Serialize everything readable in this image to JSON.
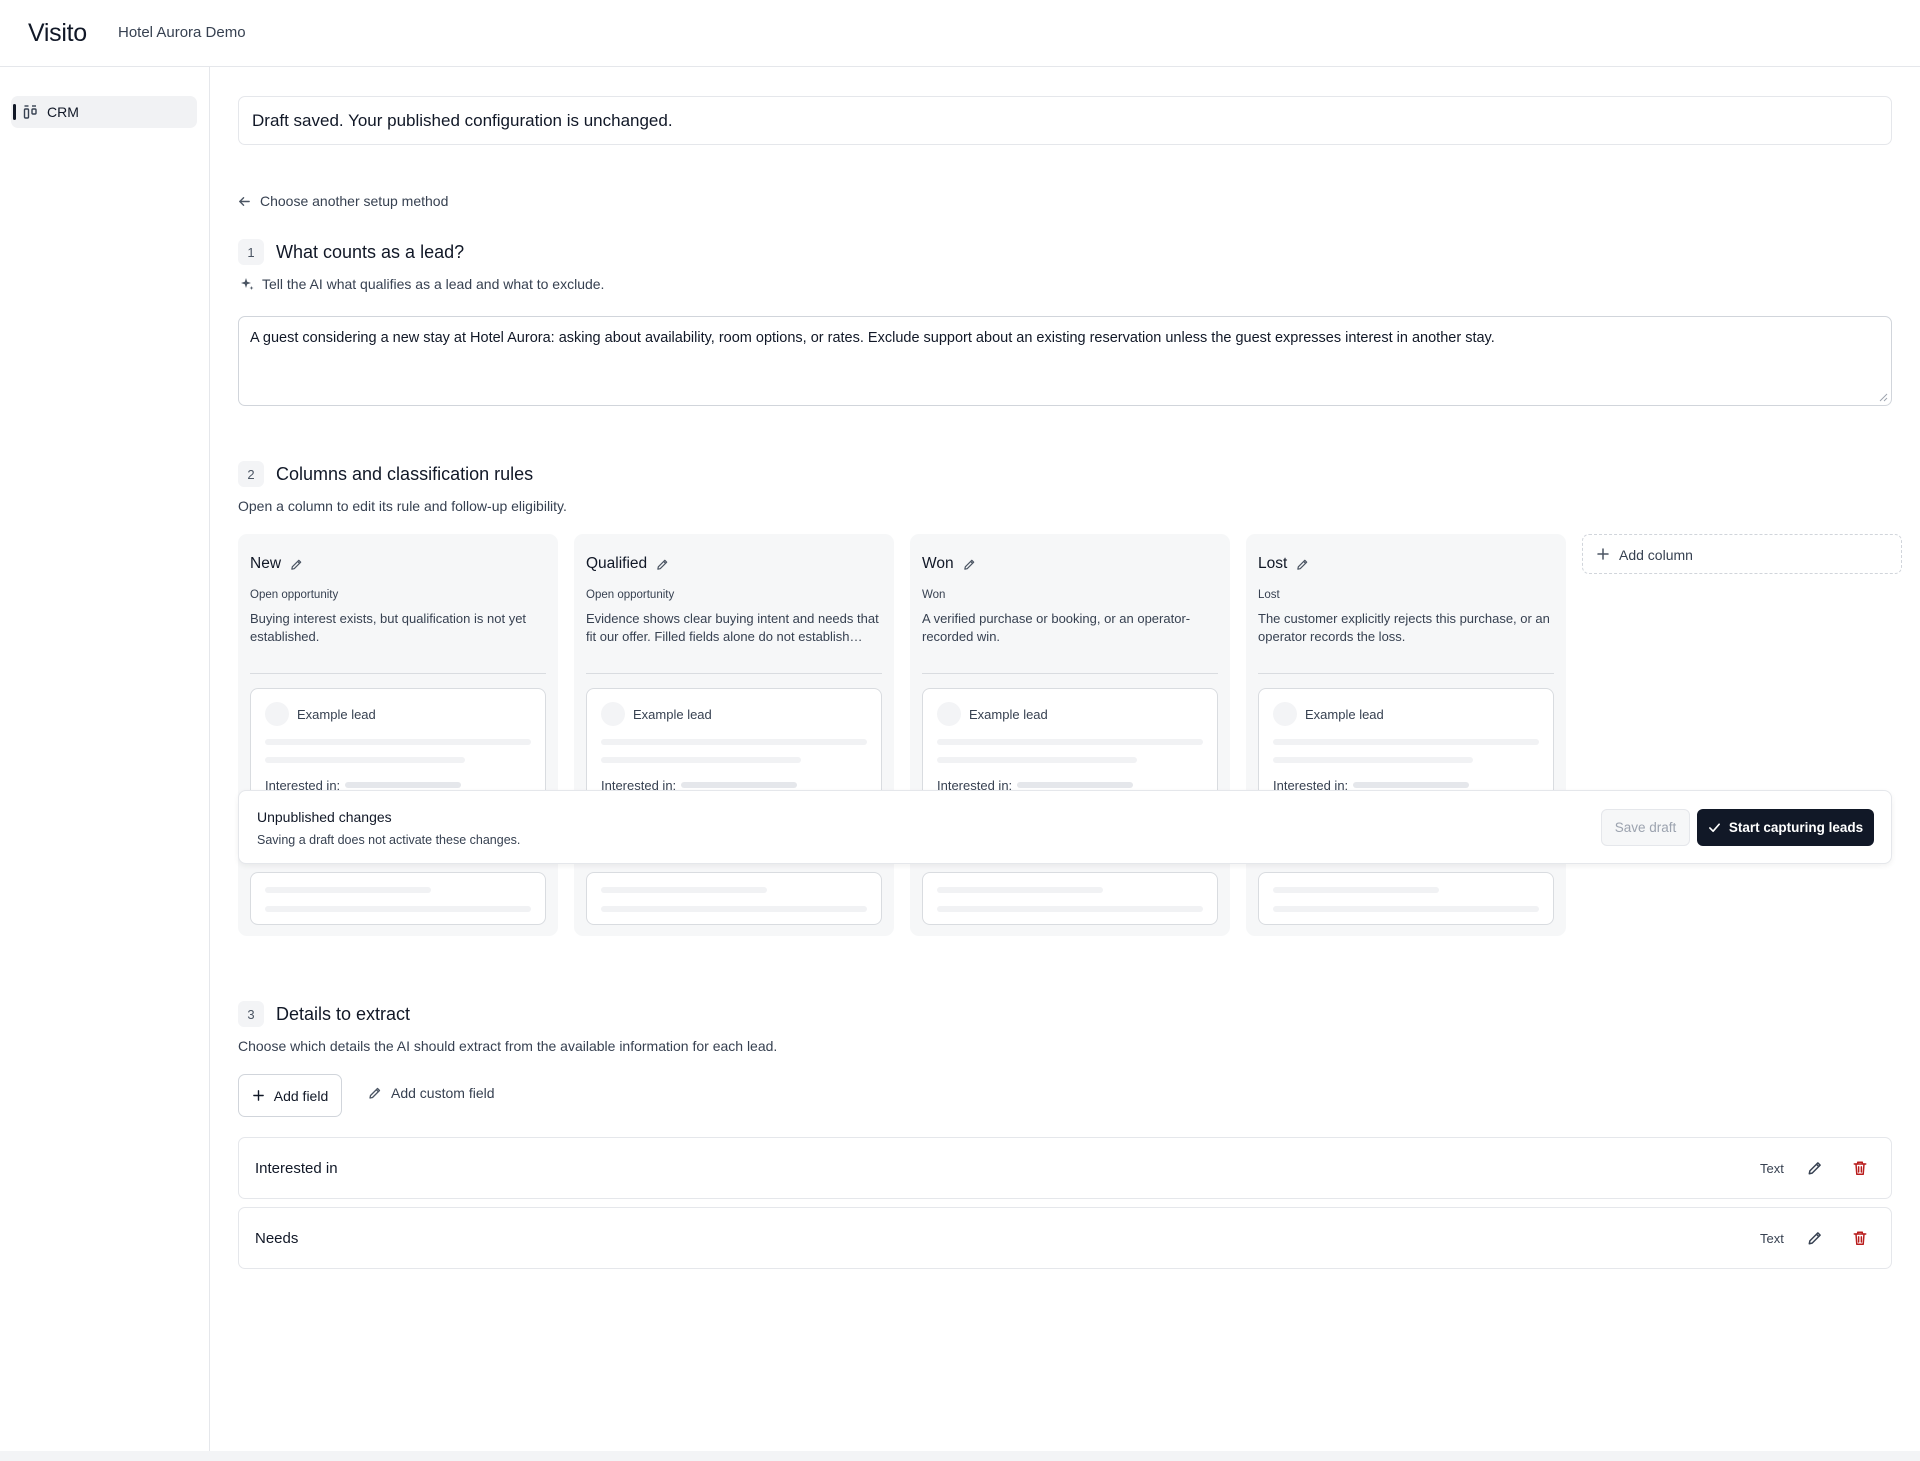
{
  "app": {
    "brand": "Visito",
    "workspace": "Hotel Aurora Demo"
  },
  "sidebar": {
    "items": [
      {
        "label": "CRM",
        "icon": "crm-icon"
      }
    ]
  },
  "toast": {
    "message": "Draft saved. Your published configuration is unchanged."
  },
  "back_link": {
    "label": "Choose another setup method",
    "icon": "arrow-left-icon"
  },
  "section1": {
    "number": "1",
    "title": "What counts as a lead?",
    "hint": "Tell the AI what qualifies as a lead and what to exclude.",
    "hint_icon": "sparkle-icon",
    "definition": "A guest considering a new stay at Hotel Aurora: asking about availability, room options, or rates. Exclude support about an existing reservation unless the guest expresses interest in another stay."
  },
  "section2": {
    "number": "2",
    "title": "Columns and classification rules",
    "description": "Open a column to edit its rule and follow-up eligibility.",
    "columns": [
      {
        "name": "New",
        "type": "Open opportunity",
        "rule": "Buying interest exists, but qualification is not yet established.",
        "example": "Example lead",
        "interested_label": "Interested in:"
      },
      {
        "name": "Qualified",
        "type": "Open opportunity",
        "rule": "Evidence shows clear buying intent and needs that fit our offer. Filled fields alone do not establish…",
        "example": "Example lead",
        "interested_label": "Interested in:"
      },
      {
        "name": "Won",
        "type": "Won",
        "rule": "A verified purchase or booking, or an operator-recorded win.",
        "example": "Example lead",
        "interested_label": "Interested in:"
      },
      {
        "name": "Lost",
        "type": "Lost",
        "rule": "The customer explicitly rejects this purchase, or an operator records the loss.",
        "example": "Example lead",
        "interested_label": "Interested in:"
      }
    ],
    "add_column_label": "Add column"
  },
  "unpublished": {
    "title": "Unpublished changes",
    "subtitle": "Saving a draft does not activate these changes.",
    "save_label": "Save draft",
    "start_label": "Start capturing leads"
  },
  "section3": {
    "number": "3",
    "title": "Details to extract",
    "description": "Choose which details the AI should extract from the available information for each lead.",
    "add_field_label": "Add field",
    "add_custom_label": "Add custom field",
    "fields": [
      {
        "name": "Interested in",
        "type": "Text"
      },
      {
        "name": "Needs",
        "type": "Text"
      }
    ]
  },
  "colors": {
    "primary": "#111827",
    "danger": "#b91c1c",
    "surface": "#f6f7f8",
    "border": "#e5e7eb"
  }
}
